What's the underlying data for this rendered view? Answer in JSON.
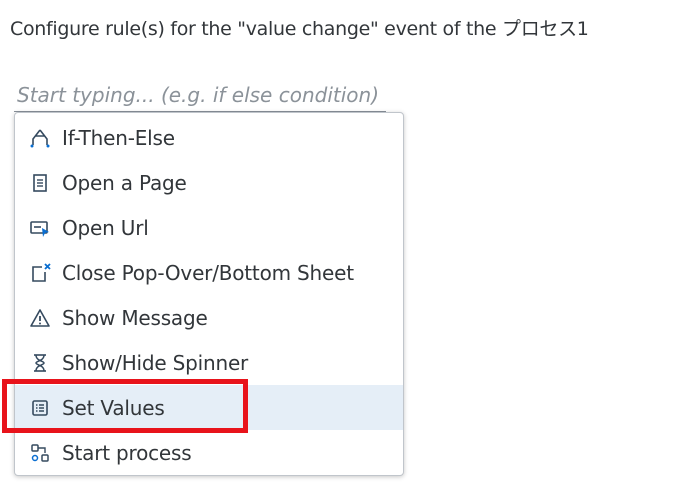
{
  "dialog": {
    "title": "Configure rule(s) for the \"value change\" event of the プロセス1"
  },
  "search": {
    "placeholder": "Start typing... (e.g. if else condition)",
    "value": ""
  },
  "menu": {
    "items": [
      {
        "label": "If-Then-Else",
        "icon": "if-then-else-icon"
      },
      {
        "label": "Open a Page",
        "icon": "page-icon"
      },
      {
        "label": "Open Url",
        "icon": "open-url-icon"
      },
      {
        "label": "Close Pop-Over/Bottom Sheet",
        "icon": "close-popover-icon"
      },
      {
        "label": "Show Message",
        "icon": "warning-icon"
      },
      {
        "label": "Show/Hide Spinner",
        "icon": "hourglass-icon"
      },
      {
        "label": "Set Values",
        "icon": "list-icon"
      },
      {
        "label": "Start process",
        "icon": "process-icon"
      }
    ],
    "hovered_index": 6
  },
  "colors": {
    "icon": "#354a5f",
    "icon_accent": "#0a6ed1",
    "close_accent": "#0a6ed1",
    "hover_background": "#e5eef7",
    "highlight_border": "#e8131b"
  }
}
